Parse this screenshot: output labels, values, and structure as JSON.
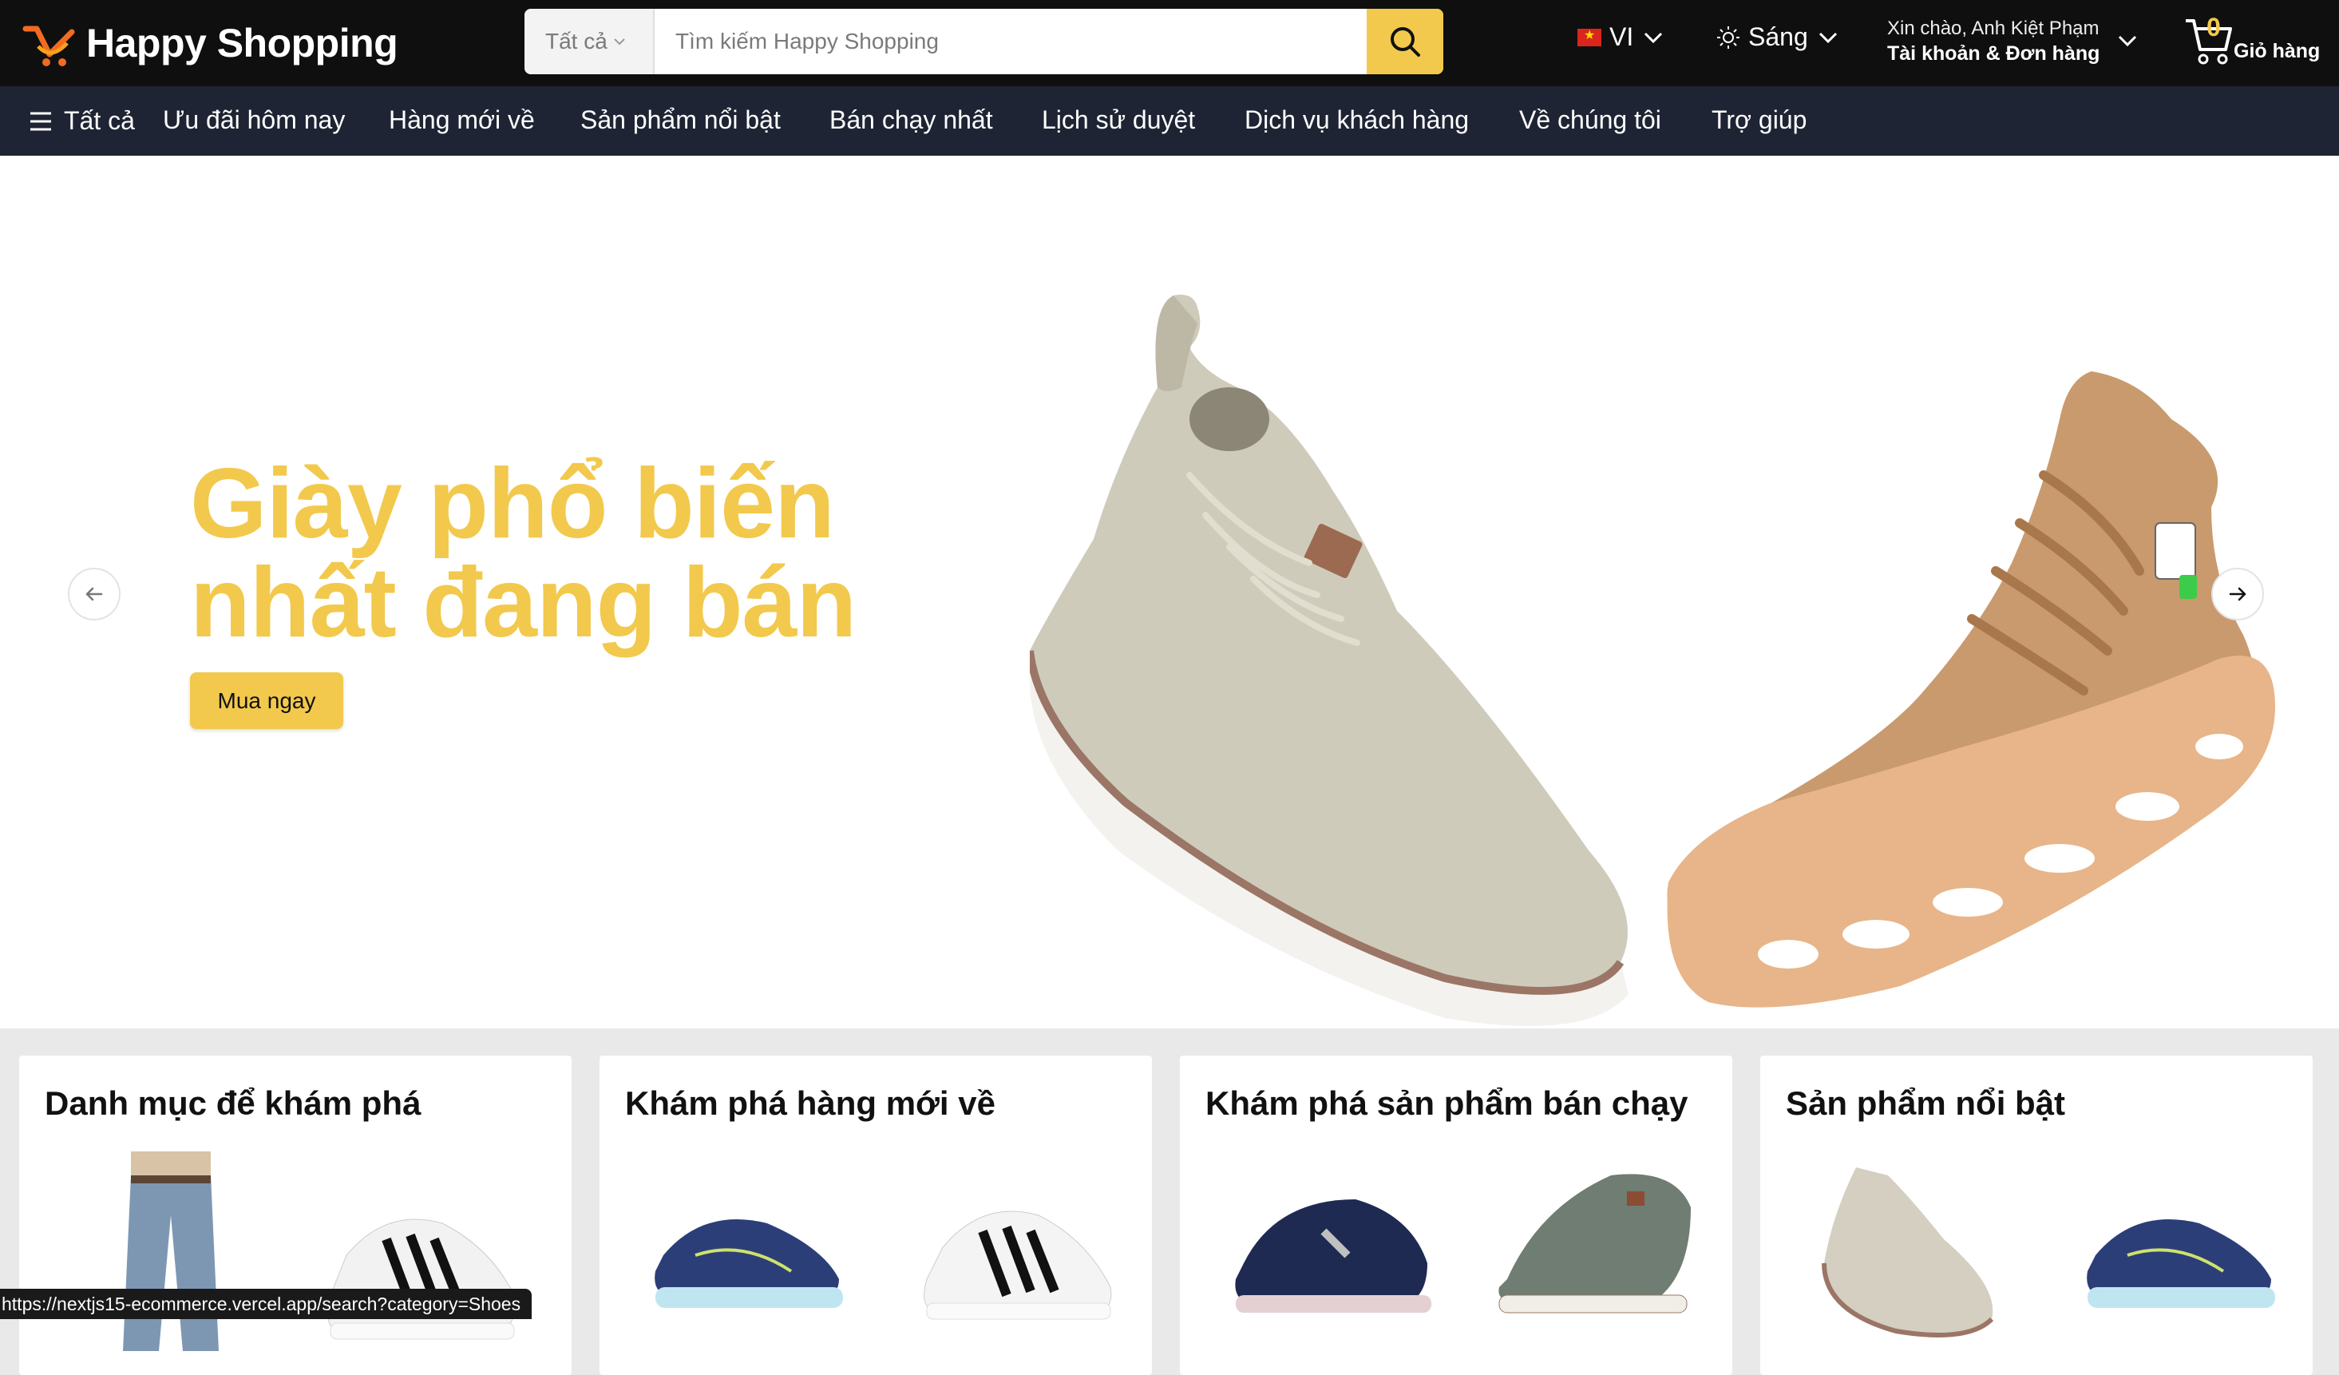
{
  "header": {
    "logo_text": "Happy Shopping",
    "search": {
      "category": "Tất cả",
      "placeholder": "Tìm kiếm Happy Shopping"
    },
    "language": "VI",
    "theme": "Sáng",
    "account": {
      "greeting": "Xin chào, Anh Kiệt Phạm",
      "label": "Tài khoản & Đơn hàng"
    },
    "cart": {
      "count": "0",
      "label": "Giỏ hàng"
    }
  },
  "nav": {
    "all_label": "Tất cả",
    "items": [
      "Ưu đãi hôm nay",
      "Hàng mới về",
      "Sản phẩm nổi bật",
      "Bán chạy nhất",
      "Lịch sử duyệt",
      "Dịch vụ khách hàng",
      "Về chúng tôi",
      "Trợ giúp"
    ]
  },
  "hero": {
    "title_line1": "Giày phổ biến",
    "title_line2": "nhất đang bán",
    "cta": "Mua ngay"
  },
  "cards": [
    {
      "title": "Danh mục để khám phá"
    },
    {
      "title": "Khám phá hàng mới về"
    },
    {
      "title": "Khám phá sản phẩm bán chạy"
    },
    {
      "title": "Sản phẩm nổi bật"
    }
  ],
  "status_url": "https://nextjs15-ecommerce.vercel.app/search?category=Shoes",
  "colors": {
    "accent": "#f2c94c",
    "topbar": "#0f0f0f",
    "navbar": "#1e2433"
  }
}
